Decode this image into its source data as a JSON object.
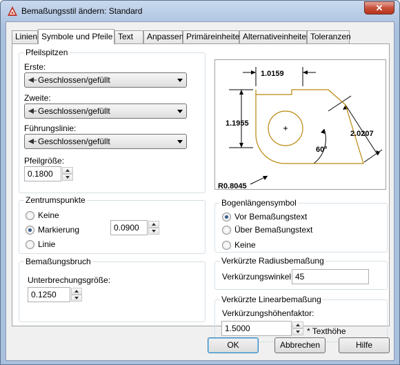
{
  "window": {
    "title": "Bemaßungsstil ändern: Standard",
    "close_label": "✕"
  },
  "tabs": [
    "Linien",
    "Symbole und Pfeile",
    "Text",
    "Anpassen",
    "Primäreinheiten",
    "Alternativeinheiten",
    "Toleranzen"
  ],
  "active_tab": "Symbole und Pfeile",
  "arrowheads": {
    "title": "Pfeilspitzen",
    "first_label": "Erste:",
    "first_value": "Geschlossen/gefüllt",
    "second_label": "Zweite:",
    "second_value": "Geschlossen/gefüllt",
    "leader_label": "Führungslinie:",
    "leader_value": "Geschlossen/gefüllt",
    "size_label": "Pfeilgröße:",
    "size_value": "0.1800"
  },
  "center_marks": {
    "title": "Zentrumspunkte",
    "options": [
      "Keine",
      "Markierung",
      "Linie"
    ],
    "selected": "Markierung",
    "size_value": "0.0900"
  },
  "dim_break": {
    "title": "Bemaßungsbruch",
    "label": "Unterbrechungsgröße:",
    "value": "0.1250"
  },
  "preview": {
    "dim_top": "1.0159",
    "dim_left": "1.1955",
    "dim_right": "2.0207",
    "angle": "60°",
    "radius": "R0.8045"
  },
  "arc_length": {
    "title": "Bogenlängensymbol",
    "options": [
      "Vor Bemaßungstext",
      "Über Bemaßungstext",
      "Keine"
    ],
    "selected": "Vor Bemaßungstext"
  },
  "radius_jog": {
    "title": "Verkürzte Radiusbemaßung",
    "label": "Verkürzungswinkel:",
    "value": "45"
  },
  "linear_jog": {
    "title": "Verkürzte Linearbemaßung",
    "label": "Verkürzungshöhenfaktor:",
    "value": "1.5000",
    "suffix": "* Texthöhe"
  },
  "buttons": {
    "ok": "OK",
    "cancel": "Abbrechen",
    "help": "Hilfe"
  },
  "colors": {
    "accent": "#3c7fb1",
    "preview_shape": "#b8860b",
    "brand": "#c0392b"
  }
}
